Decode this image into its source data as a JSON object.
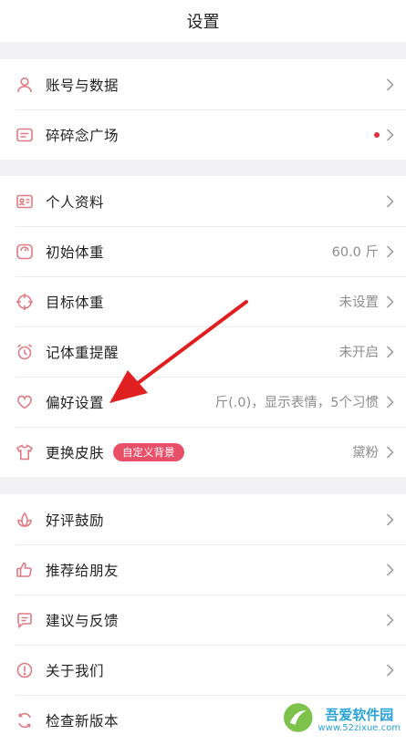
{
  "header": {
    "title": "设置"
  },
  "groups": [
    {
      "items": [
        {
          "label": "账号与数据",
          "icon": "user-icon"
        },
        {
          "label": "碎碎念广场",
          "icon": "message-square-icon",
          "has_red_dot": true
        }
      ]
    },
    {
      "items": [
        {
          "label": "个人资料",
          "icon": "id-card-icon"
        },
        {
          "label": "初始体重",
          "icon": "scale-icon",
          "value": "60.0 斤"
        },
        {
          "label": "目标体重",
          "icon": "target-icon",
          "value": "未设置"
        },
        {
          "label": "记体重提醒",
          "icon": "alarm-clock-icon",
          "value": "未开启"
        },
        {
          "label": "偏好设置",
          "icon": "heart-icon",
          "value": "斤(.0)，显示表情，5个习惯"
        },
        {
          "label": "更换皮肤",
          "icon": "shirt-icon",
          "badge": "自定义背景",
          "value": "黛粉"
        }
      ]
    },
    {
      "items": [
        {
          "label": "好评鼓励",
          "icon": "flower-icon"
        },
        {
          "label": "推荐给朋友",
          "icon": "thumbs-up-icon"
        },
        {
          "label": "建议与反馈",
          "icon": "chat-icon"
        },
        {
          "label": "关于我们",
          "icon": "info-circle-icon"
        },
        {
          "label": "检查新版本",
          "icon": "refresh-icon"
        }
      ]
    }
  ],
  "watermark": {
    "name": "吾爱软件园",
    "url": "www.52zixue.com"
  },
  "colors": {
    "accent": "#e8506a",
    "arrow": "#e02020",
    "icon": "#e07a84",
    "badge_bg": "#e8506a"
  }
}
